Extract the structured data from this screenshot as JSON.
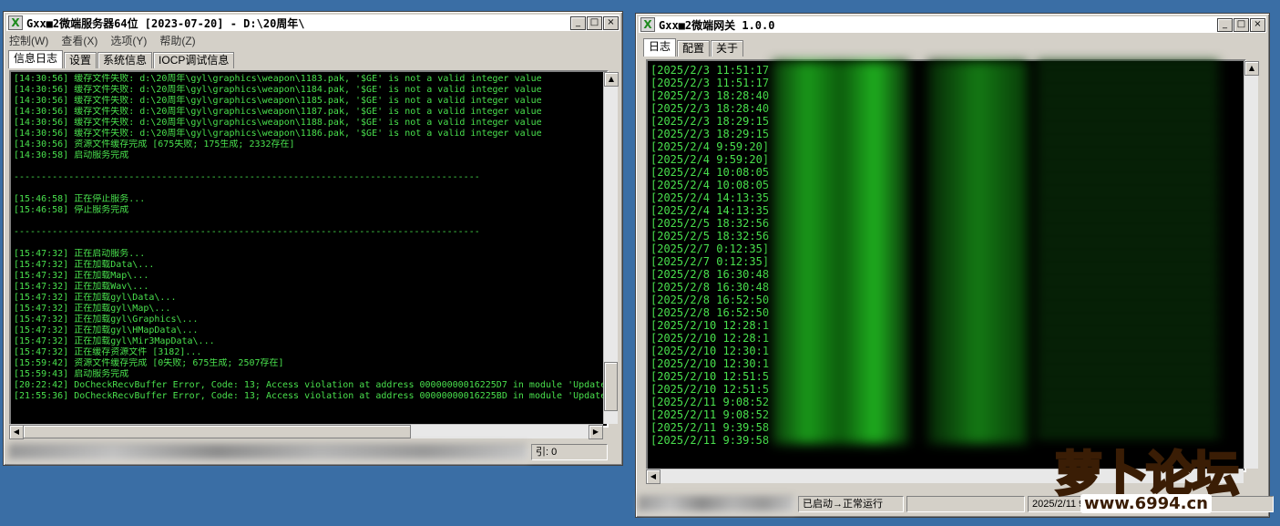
{
  "window1": {
    "title": "Gxx■2微端服务器64位 [2023-07-20] - D:\\20周年\\",
    "menu": [
      "控制(W)",
      "查看(X)",
      "选项(Y)",
      "帮助(Z)"
    ],
    "tabs": [
      "信息日志",
      "设置",
      "系统信息",
      "IOCP调试信息"
    ],
    "log_lines": [
      "[14:30:56] 缓存文件失败: d:\\20周年\\gyl\\graphics\\weapon\\1183.pak, '$GE' is not a valid integer value",
      "[14:30:56] 缓存文件失败: d:\\20周年\\gyl\\graphics\\weapon\\1184.pak, '$GE' is not a valid integer value",
      "[14:30:56] 缓存文件失败: d:\\20周年\\gyl\\graphics\\weapon\\1185.pak, '$GE' is not a valid integer value",
      "[14:30:56] 缓存文件失败: d:\\20周年\\gyl\\graphics\\weapon\\1187.pak, '$GE' is not a valid integer value",
      "[14:30:56] 缓存文件失败: d:\\20周年\\gyl\\graphics\\weapon\\1188.pak, '$GE' is not a valid integer value",
      "[14:30:56] 缓存文件失败: d:\\20周年\\gyl\\graphics\\weapon\\1186.pak, '$GE' is not a valid integer value",
      "[14:30:56] 资源文件缓存完成 [675失败; 175生成; 2332存在]",
      "[14:30:58] 启动服务完成",
      "",
      "-------------------------------------------------------------------------------------",
      "",
      "[15:46:58] 正在停止服务...",
      "[15:46:58] 停止服务完成",
      "",
      "-------------------------------------------------------------------------------------",
      "",
      "[15:47:32] 正在启动服务...",
      "[15:47:32] 正在加载Data\\...",
      "[15:47:32] 正在加载Map\\...",
      "[15:47:32] 正在加载Wav\\...",
      "[15:47:32] 正在加载gyl\\Data\\...",
      "[15:47:32] 正在加载gyl\\Map\\...",
      "[15:47:32] 正在加载gyl\\Graphics\\...",
      "[15:47:32] 正在加载gyl\\HMapData\\...",
      "[15:47:32] 正在加载gyl\\Mir3MapData\\...",
      "[15:47:32] 正在缓存资源文件 [3182]...",
      "[15:59:42] 资源文件缓存完成 [0失败; 675生成; 2507存在]",
      "[15:59:43] 启动服务完成",
      "[20:22:42] DoCheckRecvBuffer Error, Code: 13; Access violation at address 00000000016225D7 in module 'Update",
      "[21:55:36] DoCheckRecvBuffer Error, Code: 13; Access violation at address 00000000016225BD in module 'Update"
    ],
    "status_tail": "引: 0"
  },
  "window2": {
    "title": "Gxx■2微端网关 1.0.0",
    "tabs": [
      "日志",
      "配置",
      "关于"
    ],
    "log_times": [
      "[2025/2/3 11:51:17",
      "[2025/2/3 11:51:17",
      "[2025/2/3 18:28:40",
      "[2025/2/3 18:28:40",
      "[2025/2/3 18:29:15",
      "[2025/2/3 18:29:15",
      "[2025/2/4 9:59:20]",
      "[2025/2/4 9:59:20]",
      "[2025/2/4 10:08:05",
      "[2025/2/4 10:08:05",
      "[2025/2/4 14:13:35",
      "[2025/2/4 14:13:35",
      "[2025/2/5 18:32:56",
      "[2025/2/5 18:32:56",
      "[2025/2/7 0:12:35]",
      "[2025/2/7 0:12:35]",
      "[2025/2/8 16:30:48",
      "[2025/2/8 16:30:48",
      "[2025/2/8 16:52:50",
      "[2025/2/8 16:52:50",
      "[2025/2/10 12:28:1",
      "[2025/2/10 12:28:1",
      "[2025/2/10 12:30:1",
      "[2025/2/10 12:30:1",
      "[2025/2/10 12:51:5",
      "[2025/2/10 12:51:5",
      "[2025/2/11 9:08:52",
      "[2025/2/11 9:08:52",
      "[2025/2/11 9:39:58",
      "[2025/2/11 9:39:58"
    ],
    "status": {
      "state": "已启动→正常运行",
      "date": "2025/2/11 9"
    }
  },
  "watermark": {
    "brand": "萝卜论坛",
    "url": "www.6994.cn"
  }
}
